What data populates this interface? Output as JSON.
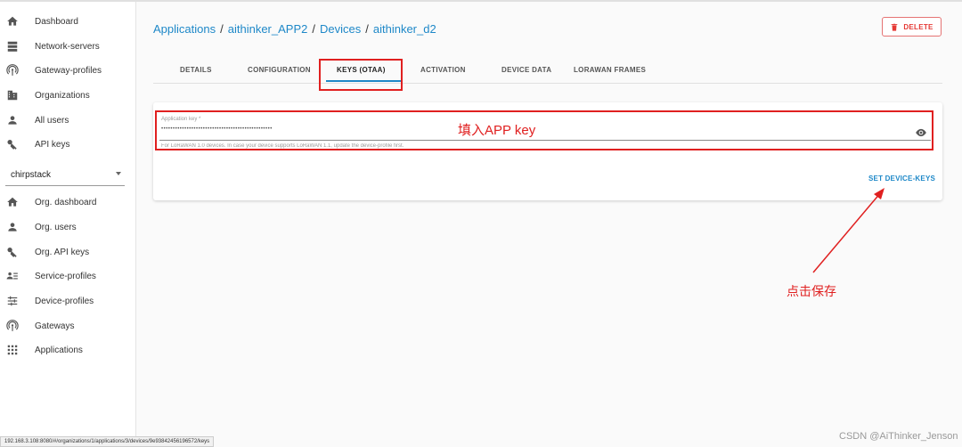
{
  "sidebar": {
    "admin_items": [
      {
        "label": "Dashboard",
        "icon": "home-icon"
      },
      {
        "label": "Network-servers",
        "icon": "server-icon"
      },
      {
        "label": "Gateway-profiles",
        "icon": "radio-tower-icon"
      },
      {
        "label": "Organizations",
        "icon": "domain-icon"
      },
      {
        "label": "All users",
        "icon": "account-icon"
      },
      {
        "label": "API keys",
        "icon": "key-icon"
      }
    ],
    "org_select": {
      "value": "chirpstack"
    },
    "org_items": [
      {
        "label": "Org. dashboard",
        "icon": "home-icon"
      },
      {
        "label": "Org. users",
        "icon": "account-icon"
      },
      {
        "label": "Org. API keys",
        "icon": "key-icon"
      },
      {
        "label": "Service-profiles",
        "icon": "account-details-icon"
      },
      {
        "label": "Device-profiles",
        "icon": "tune-icon"
      },
      {
        "label": "Gateways",
        "icon": "radio-tower-icon"
      },
      {
        "label": "Applications",
        "icon": "apps-icon"
      }
    ]
  },
  "breadcrumb": {
    "items": [
      "Applications",
      "aithinker_APP2",
      "Devices",
      "aithinker_d2"
    ],
    "separator": "/"
  },
  "header": {
    "delete_label": "DELETE"
  },
  "tabs": [
    {
      "label": "DETAILS"
    },
    {
      "label": "CONFIGURATION"
    },
    {
      "label": "KEYS (OTAA)",
      "active": true
    },
    {
      "label": "ACTIVATION"
    },
    {
      "label": "DEVICE DATA"
    },
    {
      "label": "LORAWAN FRAMES"
    }
  ],
  "form": {
    "app_key_label": "Application key *",
    "app_key_value": "••••••••••••••••••••••••••••••••••••••••••••••••",
    "helper_text": "For LoRaWAN 1.0 devices. In case your device supports LoRaWAN 1.1, update the device-profile first.",
    "submit_label": "SET DEVICE-KEYS"
  },
  "annotations": {
    "fill_key": "填入APP key",
    "click_save": "点击保存"
  },
  "status_url": "192.168.3.108:8080/#/organizations/1/applications/3/devices/9e93842456196572/keys",
  "watermark": "CSDN @AiThinker_Jenson",
  "colors": {
    "accent": "#1e88c8",
    "annotation": "#e02020",
    "delete": "#e53935"
  }
}
